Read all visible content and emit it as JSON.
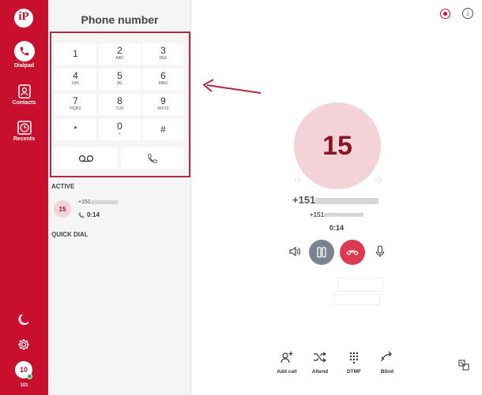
{
  "sidebar": {
    "logo_text": "iP",
    "items": [
      {
        "label": "Dialpad",
        "icon": "phone-icon"
      },
      {
        "label": "Contacts",
        "icon": "contacts-icon"
      },
      {
        "label": "Recents",
        "icon": "recents-icon"
      }
    ],
    "avatar_text": "10",
    "extension": "101"
  },
  "dialpad": {
    "title": "Phone number",
    "keys": [
      {
        "digit": "1",
        "letters": ""
      },
      {
        "digit": "2",
        "letters": "ABC"
      },
      {
        "digit": "3",
        "letters": "DEF"
      },
      {
        "digit": "4",
        "letters": "GHI"
      },
      {
        "digit": "5",
        "letters": "JKL"
      },
      {
        "digit": "6",
        "letters": "MNO"
      },
      {
        "digit": "7",
        "letters": "PQRS"
      },
      {
        "digit": "8",
        "letters": "TUV"
      },
      {
        "digit": "9",
        "letters": "WXYZ"
      },
      {
        "digit": "*",
        "letters": ""
      },
      {
        "digit": "0",
        "letters": "+"
      },
      {
        "digit": "#",
        "letters": ""
      }
    ]
  },
  "active": {
    "label": "ACTIVE",
    "avatar": "15",
    "number_prefix": "+151",
    "timer": "0:14"
  },
  "quick_dial": {
    "label": "QUICK DIAL"
  },
  "call": {
    "avatar": "15",
    "number_prefix": "+151",
    "sub_prefix": "+151",
    "timer": "0:14",
    "actions": [
      {
        "label": "Add call",
        "icon": "add-call-icon"
      },
      {
        "label": "Attend",
        "icon": "attend-transfer-icon"
      },
      {
        "label": "DTMF",
        "icon": "dtmf-keypad-icon"
      },
      {
        "label": "Blind",
        "icon": "blind-transfer-icon"
      }
    ]
  },
  "colors": {
    "brand": "#c8102e",
    "hangup": "#dc3a50",
    "hold": "#7a8490",
    "avatar_bg": "#f3d3d8"
  }
}
